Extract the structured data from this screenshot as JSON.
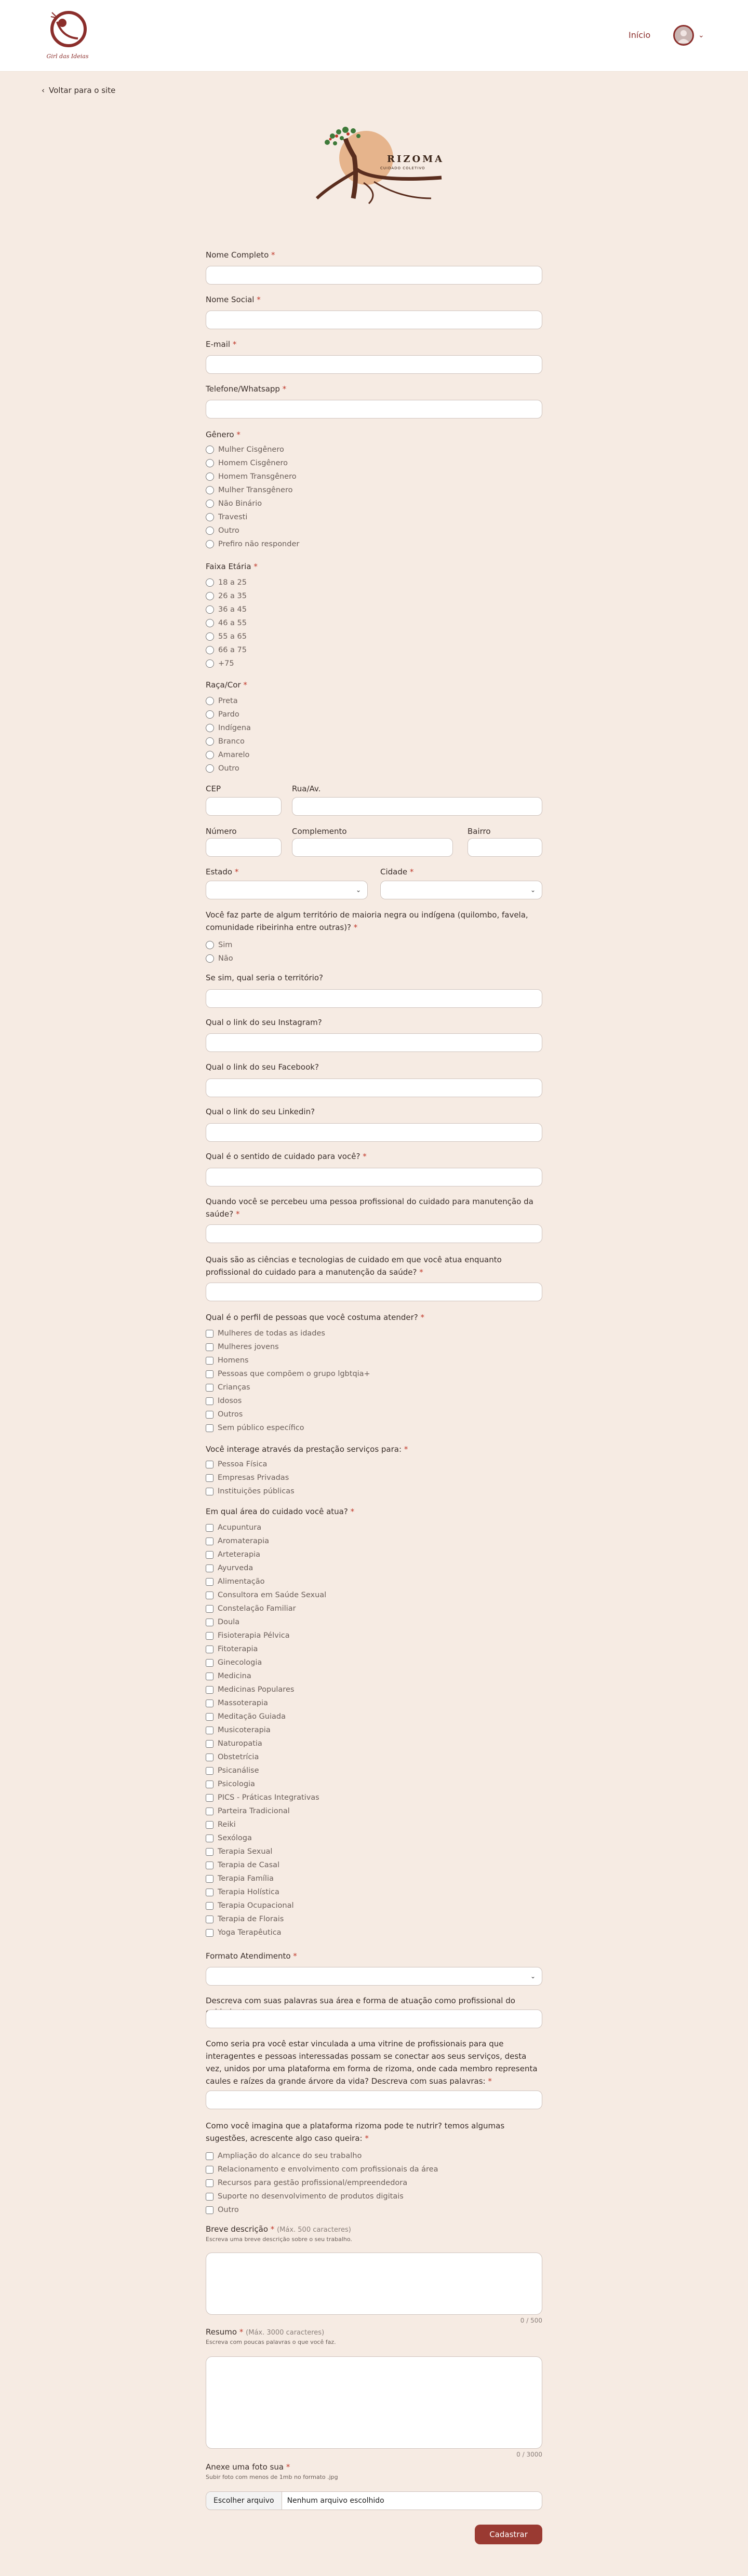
{
  "header": {
    "brand_text": "Girl das Ideias",
    "nav_link": "Início"
  },
  "back_link": "Voltar para o site",
  "hero_logo_text": "RIZOMA",
  "hero_logo_subtext": "CUIDADO COLETIVO",
  "colors": {
    "accent": "#8b2e2b",
    "button": "#9a3a32",
    "background": "#f6ebe3"
  },
  "form": {
    "nome_completo": "Nome Completo",
    "nome_social": "Nome Social",
    "email": "E-mail",
    "telefone": "Telefone/Whatsapp",
    "genero": "Gênero",
    "genero_opts": [
      "Mulher Cisgênero",
      "Homem Cisgênero",
      "Homem Transgênero",
      "Mulher Transgênero",
      "Não Binário",
      "Travesti",
      "Outro",
      "Prefiro não responder"
    ],
    "faixa": "Faixa Etária",
    "faixa_opts": [
      "18 a 25",
      "26 a 35",
      "36 a 45",
      "46 a 55",
      "55 a 65",
      "66 a 75",
      "+75"
    ],
    "raca": "Raça/Cor",
    "raca_opts": [
      "Preta",
      "Pardo",
      "Indígena",
      "Branco",
      "Amarelo",
      "Outro"
    ],
    "cep": "CEP",
    "rua": "Rua/Av.",
    "numero": "Número",
    "complemento": "Complemento",
    "bairro": "Bairro",
    "estado": "Estado",
    "cidade": "Cidade",
    "territorio_q": "Você faz parte de algum território de maioria negra ou indígena (quilombo, favela, comunidade ribeirinha entre outras)?",
    "territorio_opts": [
      "Sim",
      "Não"
    ],
    "territorio_qual": "Se sim, qual seria o território?",
    "instagram": "Qual o link do seu Instagram?",
    "facebook": "Qual o link do seu Facebook?",
    "linkedin": "Qual o link do seu Linkedin?",
    "sentido": "Qual é o sentido de cuidado para você?",
    "quando": "Quando você se percebeu uma pessoa profissional do cuidado para manutenção da saúde?",
    "ciencias": "Quais são as ciências e tecnologias de cuidado em que você atua enquanto profissional do cuidado para a manutenção da saúde?",
    "perfil": "Qual é o perfil de pessoas que você costuma atender?",
    "perfil_opts": [
      "Mulheres de todas as idades",
      "Mulheres jovens",
      "Homens",
      "Pessoas que compõem o grupo lgbtqia+",
      "Crianças",
      "Idosos",
      "Outros",
      "Sem público específico"
    ],
    "interage": "Você interage através da prestação serviços para:",
    "interage_opts": [
      "Pessoa Física",
      "Empresas Privadas",
      "Instituições públicas"
    ],
    "area": "Em qual área do cuidado você atua?",
    "area_opts": [
      "Acupuntura",
      "Aromaterapia",
      "Arteterapia",
      "Ayurveda",
      "Alimentação",
      "Consultora em Saúde Sexual",
      "Constelação Familiar",
      "Doula",
      "Fisioterapia Pélvica",
      "Fitoterapia",
      "Ginecologia",
      "Medicina",
      "Medicinas Populares",
      "Massoterapia",
      "Meditação Guiada",
      "Musicoterapia",
      "Naturopatia",
      "Obstetrícia",
      "Psicanálise",
      "Psicologia",
      "PICS - Práticas Integrativas",
      "Parteira Tradicional",
      "Reiki",
      "Sexóloga",
      "Terapia Sexual",
      "Terapia de Casal",
      "Terapia Família",
      "Terapia Holística",
      "Terapia Ocupacional",
      "Terapia de Florais",
      "Yoga Terapêutica"
    ],
    "formato": "Formato Atendimento",
    "descreva": "Descreva com suas palavras sua área e forma de atuação como profissional do cuidado:",
    "vitrine": "Como seria pra você estar vinculada a uma vitrine de profissionais para que interagentes e pessoas interessadas possam se conectar aos seus serviços, desta vez, unidos por uma plataforma em forma de rizoma, onde cada membro representa caules e raízes da grande árvore da vida? Descreva com suas palavras:",
    "nutrir": "Como você imagina que a plataforma rizoma pode te nutrir? temos algumas sugestões, acrescente algo caso queira:",
    "nutrir_opts": [
      "Ampliação do alcance do seu trabalho",
      "Relacionamento e envolvimento com profissionais da área",
      "Recursos para gestão profissional/empreendedora",
      "Suporte no desenvolvimento de produtos digitais",
      "Outro"
    ],
    "breve": "Breve descrição",
    "breve_hint": "(Máx. 500 caracteres)",
    "breve_sub": "Escreva uma breve descrição sobre o seu trabalho.",
    "breve_counter": "0 / 500",
    "resumo": "Resumo",
    "resumo_hint": "(Máx. 3000 caracteres)",
    "resumo_sub": "Escreva com poucas palavras o que você faz.",
    "resumo_counter": "0 / 3000",
    "foto": "Anexe uma foto sua",
    "foto_sub": "Subir foto com menos de 1mb no formato .jpg",
    "file_btn": "Escolher arquivo",
    "file_none": "Nenhum arquivo escolhido",
    "submit": "Cadastrar"
  }
}
